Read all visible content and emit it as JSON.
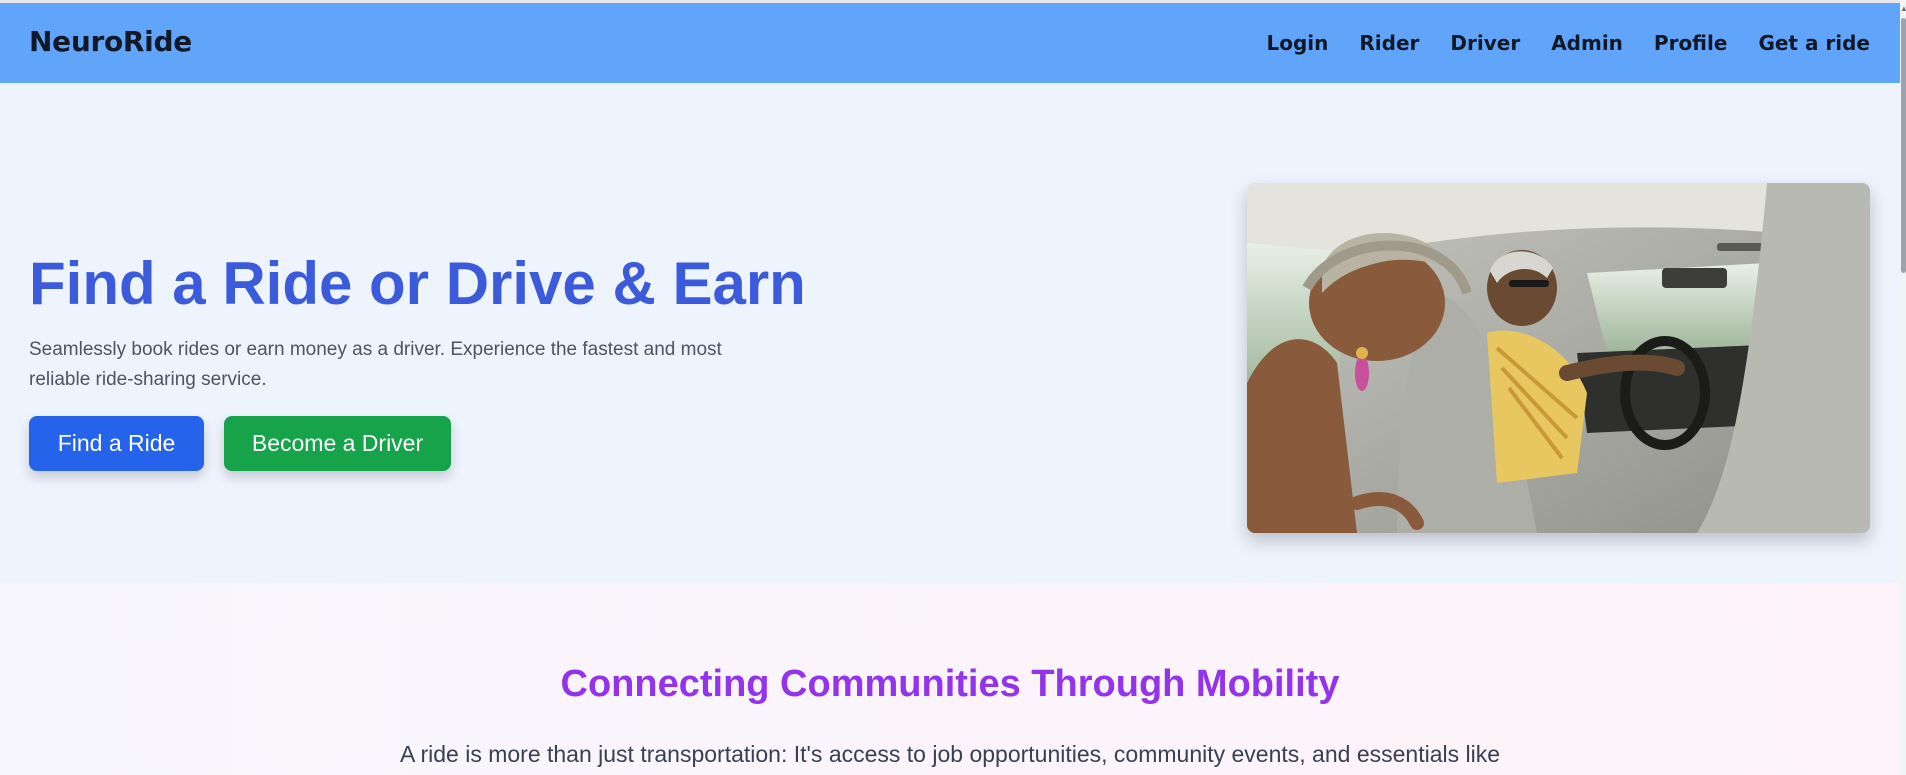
{
  "navbar": {
    "brand": "NeuroRide",
    "links": [
      "Login",
      "Rider",
      "Driver",
      "Admin",
      "Profile",
      "Get a ride"
    ]
  },
  "hero": {
    "title": "Find a Ride or Drive & Earn",
    "subtitle": "Seamlessly book rides or earn money as a driver. Experience the fastest and most reliable ride-sharing service.",
    "find_ride_label": "Find a Ride",
    "become_driver_label": "Become a Driver",
    "image_description": "Smiling passenger leaning forward while a driver steers a car"
  },
  "community": {
    "title": "Connecting Communities Through Mobility",
    "text": "A ride is more than just transportation: It's access to job opportunities, community events, and essentials like"
  },
  "colors": {
    "navbar": "#60a5fa",
    "hero_bg": "#eef4fe",
    "hero_title": "#3b5bdb",
    "find_ride_button": "#2563eb",
    "become_driver_button": "#16a34a",
    "community_title": "#9333ea"
  }
}
